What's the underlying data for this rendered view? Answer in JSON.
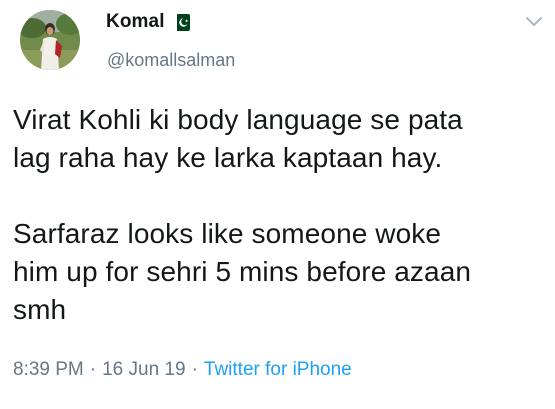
{
  "user": {
    "display_name": "Komal",
    "handle": "@komallsalman",
    "flag_icon": "pakistan-flag-icon",
    "avatar_icon": "profile-photo"
  },
  "tweet": {
    "paragraph_1": "Virat Kohli ki body language se pata\nlag raha hay ke larka kaptaan hay.",
    "paragraph_2": "Sarfaraz looks like someone woke\nhim up for sehri 5 mins before azaan\nsmh"
  },
  "meta": {
    "time": "8:39 PM",
    "date": "16 Jun 19",
    "separator": "·",
    "source": "Twitter for iPhone"
  },
  "menu": {
    "icon": "chevron-down-icon"
  },
  "colors": {
    "text": "#14171a",
    "secondary": "#657786",
    "link": "#1da1f2",
    "flag_green": "#01411c"
  }
}
